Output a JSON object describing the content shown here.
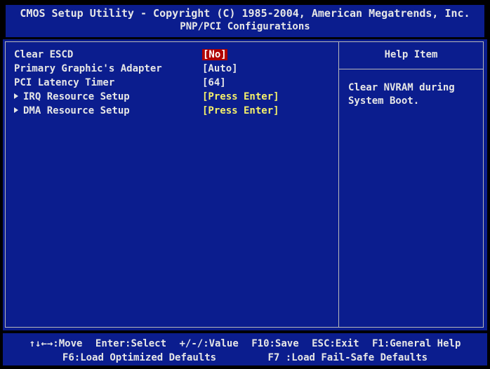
{
  "header": {
    "line1": "CMOS Setup Utility - Copyright (C) 1985-2004, American Megatrends, Inc.",
    "line2": "PNP/PCI Configurations"
  },
  "menu": {
    "items": [
      {
        "label": "Clear ESCD",
        "value": "[No]",
        "submenu": false,
        "selected": true
      },
      {
        "label": "Primary Graphic's Adapter",
        "value": "[Auto]",
        "submenu": false,
        "selected": false
      },
      {
        "label": "PCI Latency Timer",
        "value": "[64]",
        "submenu": false,
        "selected": false
      },
      {
        "label": "IRQ Resource Setup",
        "value": "[Press Enter]",
        "submenu": true,
        "selected": false
      },
      {
        "label": "DMA Resource Setup",
        "value": "[Press Enter]",
        "submenu": true,
        "selected": false
      }
    ]
  },
  "help": {
    "title": "Help Item",
    "line1": "Clear NVRAM during",
    "line2": "System Boot."
  },
  "footer": {
    "row1": [
      "↑↓←→:Move",
      "Enter:Select",
      "+/-/:Value",
      "F10:Save",
      "ESC:Exit",
      "F1:General Help"
    ],
    "row2": [
      "F6:Load Optimized Defaults",
      "F7 :Load Fail-Safe Defaults"
    ]
  },
  "colors": {
    "background": "#0b1d8e",
    "selected_bg": "#b00000",
    "submenu_value": "#f4f06a",
    "text": "#e6e6e6"
  }
}
